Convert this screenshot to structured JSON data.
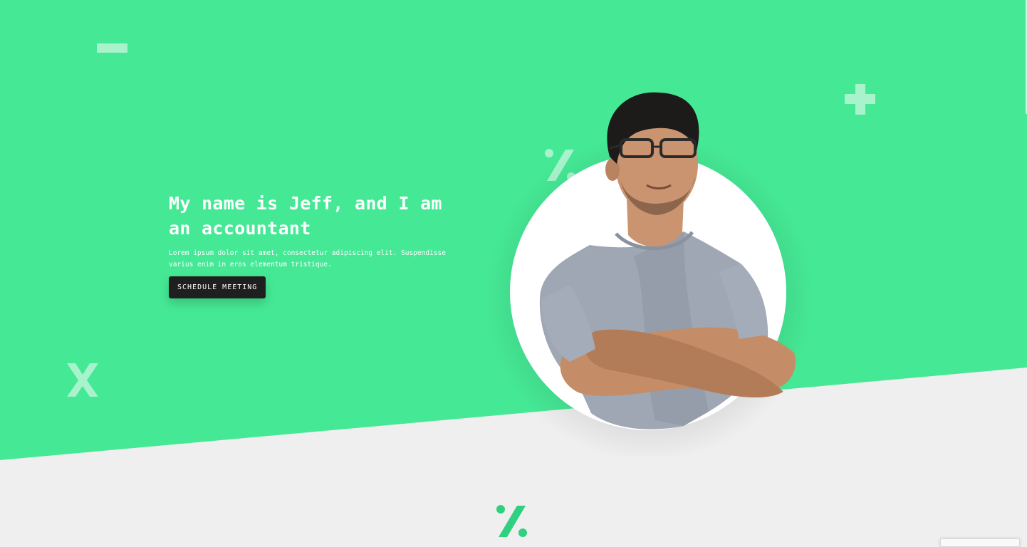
{
  "hero": {
    "title": "My name is Jeff, and I am an accountant",
    "description": "Lorem ipsum dolor sit amet, consectetur adipiscing elit. Suspendisse varius enim in eros elementum tristique.",
    "cta_label": "SCHEDULE MEETING"
  },
  "decorations": {
    "minus_symbol": "minus-icon",
    "plus_symbol": "plus-icon",
    "percent_symbol": "percent-icon",
    "times_symbol": "times-icon"
  },
  "colors": {
    "hero_green": "#45e895",
    "decor_light": "#a8f3cc",
    "section_bg": "#efefef",
    "accent_green": "#2fd07f",
    "button_bg": "#1f1f1f"
  }
}
